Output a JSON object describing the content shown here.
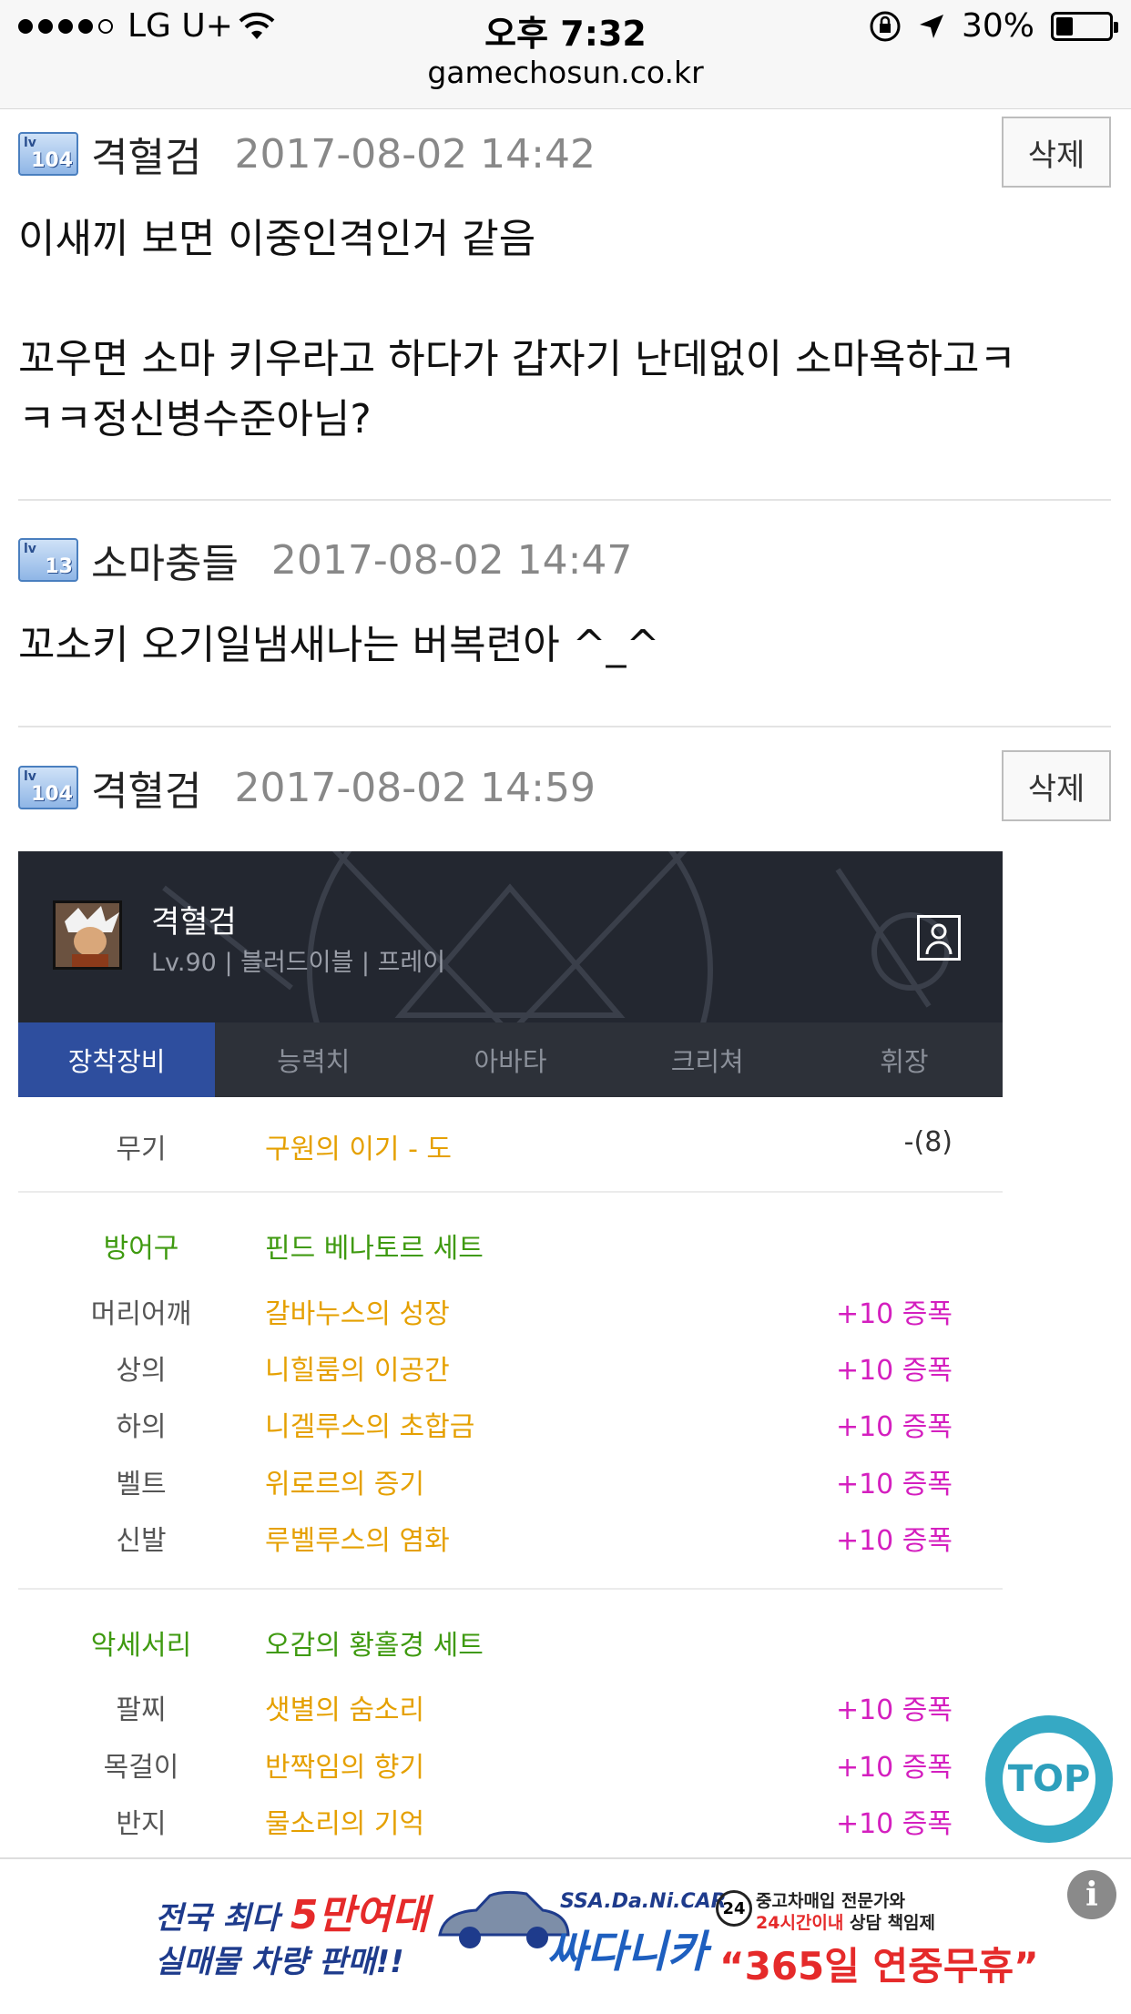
{
  "statusbar": {
    "carrier": "LG U+",
    "time": "오후 7:32",
    "battery": "30%",
    "url": "gamechosun.co.kr",
    "signal_bars": 4,
    "battery_level": 0.3
  },
  "comments": [
    {
      "level": "104",
      "nickname": "격혈검",
      "date": "2017-08-02 14:42",
      "delete_label": "삭제",
      "body_line1": "이새끼 보면 이중인격인거 같음",
      "body_line2": "꼬우면 소마 키우라고 하다가 갑자기 난데없이 소마욕하고ㅋ",
      "body_line3": "ㅋㅋ정신병수준아님?"
    },
    {
      "level": "13",
      "nickname": "소마충들",
      "date": "2017-08-02 14:47",
      "body_line1": "꼬소키 오기일냄새나는 버복련아 ^_^"
    },
    {
      "level": "104",
      "nickname": "격혈검",
      "date": "2017-08-02 14:59",
      "delete_label": "삭제"
    }
  ],
  "character_card": {
    "name": "격혈검",
    "info": "Lv.90 | 블러드이블 | 프레이",
    "tabs": [
      "장착장비",
      "능력치",
      "아바타",
      "크리쳐",
      "휘장"
    ],
    "active_tab": 0
  },
  "equipment": {
    "weapon": {
      "slot": "무기",
      "item": "구원의 이기 - 도",
      "count": "-(8)"
    },
    "armor_set": {
      "slot": "방어구",
      "name": "핀드 베나토르 세트"
    },
    "armor": [
      {
        "slot": "머리어깨",
        "item": "갈바누스의 성장",
        "enh": "+10 증폭"
      },
      {
        "slot": "상의",
        "item": "니힐룸의 이공간",
        "enh": "+10 증폭"
      },
      {
        "slot": "하의",
        "item": "니겔루스의 초합금",
        "enh": "+10 증폭"
      },
      {
        "slot": "벨트",
        "item": "위로르의 증기",
        "enh": "+10 증폭"
      },
      {
        "slot": "신발",
        "item": "루벨루스의 염화",
        "enh": "+10 증폭"
      }
    ],
    "acc_set": {
      "slot": "악세서리",
      "name": "오감의 황홀경 세트"
    },
    "accessories": [
      {
        "slot": "팔찌",
        "item": "샛별의 숨소리",
        "enh": "+10 증폭"
      },
      {
        "slot": "목걸이",
        "item": "반짝임의 향기",
        "enh": "+10 증폭"
      },
      {
        "slot": "반지",
        "item": "물소리의 기억",
        "enh": "+10 증폭"
      }
    ]
  },
  "top_button": "TOP",
  "ad": {
    "left_line1a": "전국 최다",
    "left_line1b": "5만여대",
    "left_line2": "실매물 차량 판매!!",
    "brand_small": "SSA.Da.Ni.CAR",
    "brand": "싸다니카",
    "badge": "24",
    "right_line1": "중고차매입 전문가와",
    "right_line2a": "24시간이내",
    "right_line2b": " 상담 책임제",
    "right_big": "“365일 연중무휴”",
    "info": "i"
  },
  "colors": {
    "active_tab": "#2e4e9e",
    "item_orange": "#e5a000",
    "set_green": "#3f9a10",
    "enhance_pink": "#d41fbf",
    "top_button": "#36a9c4"
  }
}
